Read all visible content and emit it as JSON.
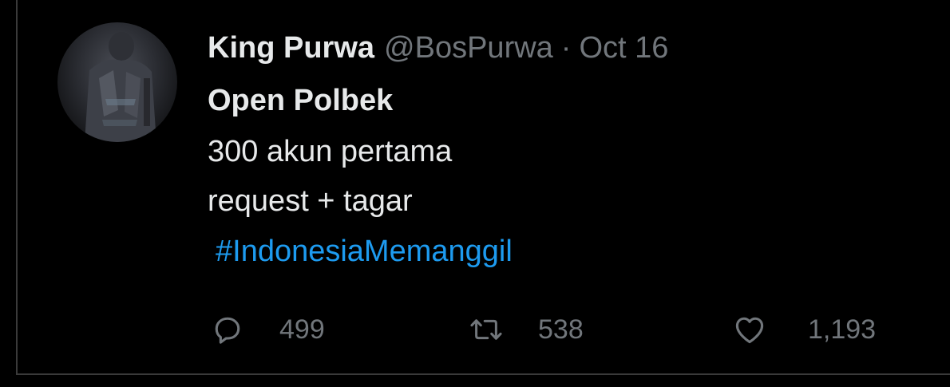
{
  "tweet": {
    "author": {
      "display_name": "King Purwa",
      "handle": "@BosPurwa"
    },
    "separator": "·",
    "date": "Oct 16",
    "text_lines": [
      "Open Polbek",
      "300 akun pertama",
      "request + tagar"
    ],
    "hashtag": "#IndonesiaMemanggil",
    "actions": {
      "reply": {
        "icon": "reply-icon",
        "count": "499"
      },
      "retweet": {
        "icon": "retweet-icon",
        "count": "538"
      },
      "like": {
        "icon": "heart-icon",
        "count": "1,193"
      }
    }
  },
  "colors": {
    "background": "#000000",
    "primary_text": "#e7e9ea",
    "secondary_text": "#71767b",
    "link": "#1d9bf0"
  }
}
